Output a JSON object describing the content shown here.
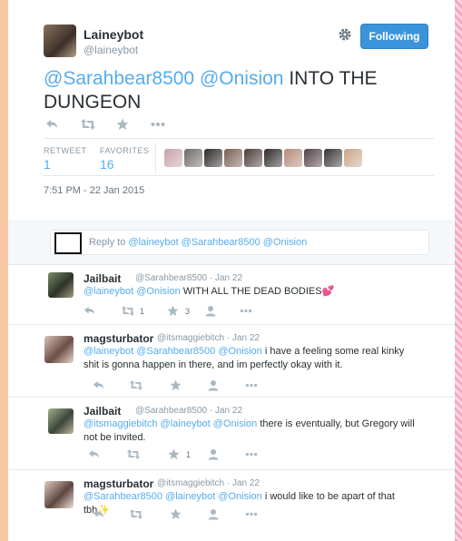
{
  "tweet": {
    "author_name": "Laineybot",
    "author_handle": "@laineybot",
    "follow_label": "Following",
    "text_mention_1": "@Sarahbear8500",
    "text_mention_2": "@Onision",
    "text_rest": "INTO THE DUNGEON",
    "stats": {
      "retweets_label": "RETWEET",
      "retweets": "1",
      "favorites_label": "FAVORITES",
      "favorites": "16"
    },
    "timestamp": "7:51 PM - 22 Jan 2015",
    "favoriters": [
      "#c7a3a8",
      "#6f6a67",
      "#2f2a28",
      "#7b5f55",
      "#4c3c3a",
      "#2e2b2a",
      "#b38a78",
      "#524048",
      "#3a3636",
      "#caa68a"
    ]
  },
  "reply_box": {
    "prefix": "Reply to",
    "mentions": "@laineybot @Sarahbear8500 @Onision"
  },
  "replies": [
    {
      "name": "Jailbait",
      "handle": "@Sarahbear8500",
      "date": "Jan 22",
      "mentions": "@laineybot @Onision",
      "body": "WITH ALL THE DEAD BODIES",
      "emoji": "💕",
      "retweet_count": "1",
      "favorite_count": "3"
    },
    {
      "name": "magsturbator",
      "handle": "@itsmaggiebitch",
      "date": "Jan 22",
      "mentions": "@laineybot @Sarahbear8500 @Onision",
      "body": "i have a feeling some real kinky shit is gonna happen in there, and im perfectly okay with it.",
      "emoji": "",
      "retweet_count": "",
      "favorite_count": ""
    },
    {
      "name": "Jailbait",
      "handle": "@Sarahbear8500",
      "date": "Jan 22",
      "mentions": "@itsmaggiebitch @laineybot @Onision",
      "body": "there is eventually, but Gregory will not be invited.",
      "emoji": "",
      "retweet_count": "",
      "favorite_count": "1"
    },
    {
      "name": "magsturbator",
      "handle": "@itsmaggiebitch",
      "date": "Jan 22",
      "mentions": "@Sarahbear8500 @laineybot @Onision",
      "body": "i would like to be apart of that tbh",
      "emoji": "✨",
      "retweet_count": "",
      "favorite_count": ""
    }
  ],
  "icons": {
    "reply": "reply-icon",
    "retweet": "retweet-icon",
    "favorite": "star-icon",
    "follow": "follow-icon",
    "more": "more-icon",
    "settings": "gear-icon"
  },
  "colors": {
    "link": "#55acee",
    "follow_button": "#3b94d9",
    "icon_gray": "#aab8c2"
  }
}
